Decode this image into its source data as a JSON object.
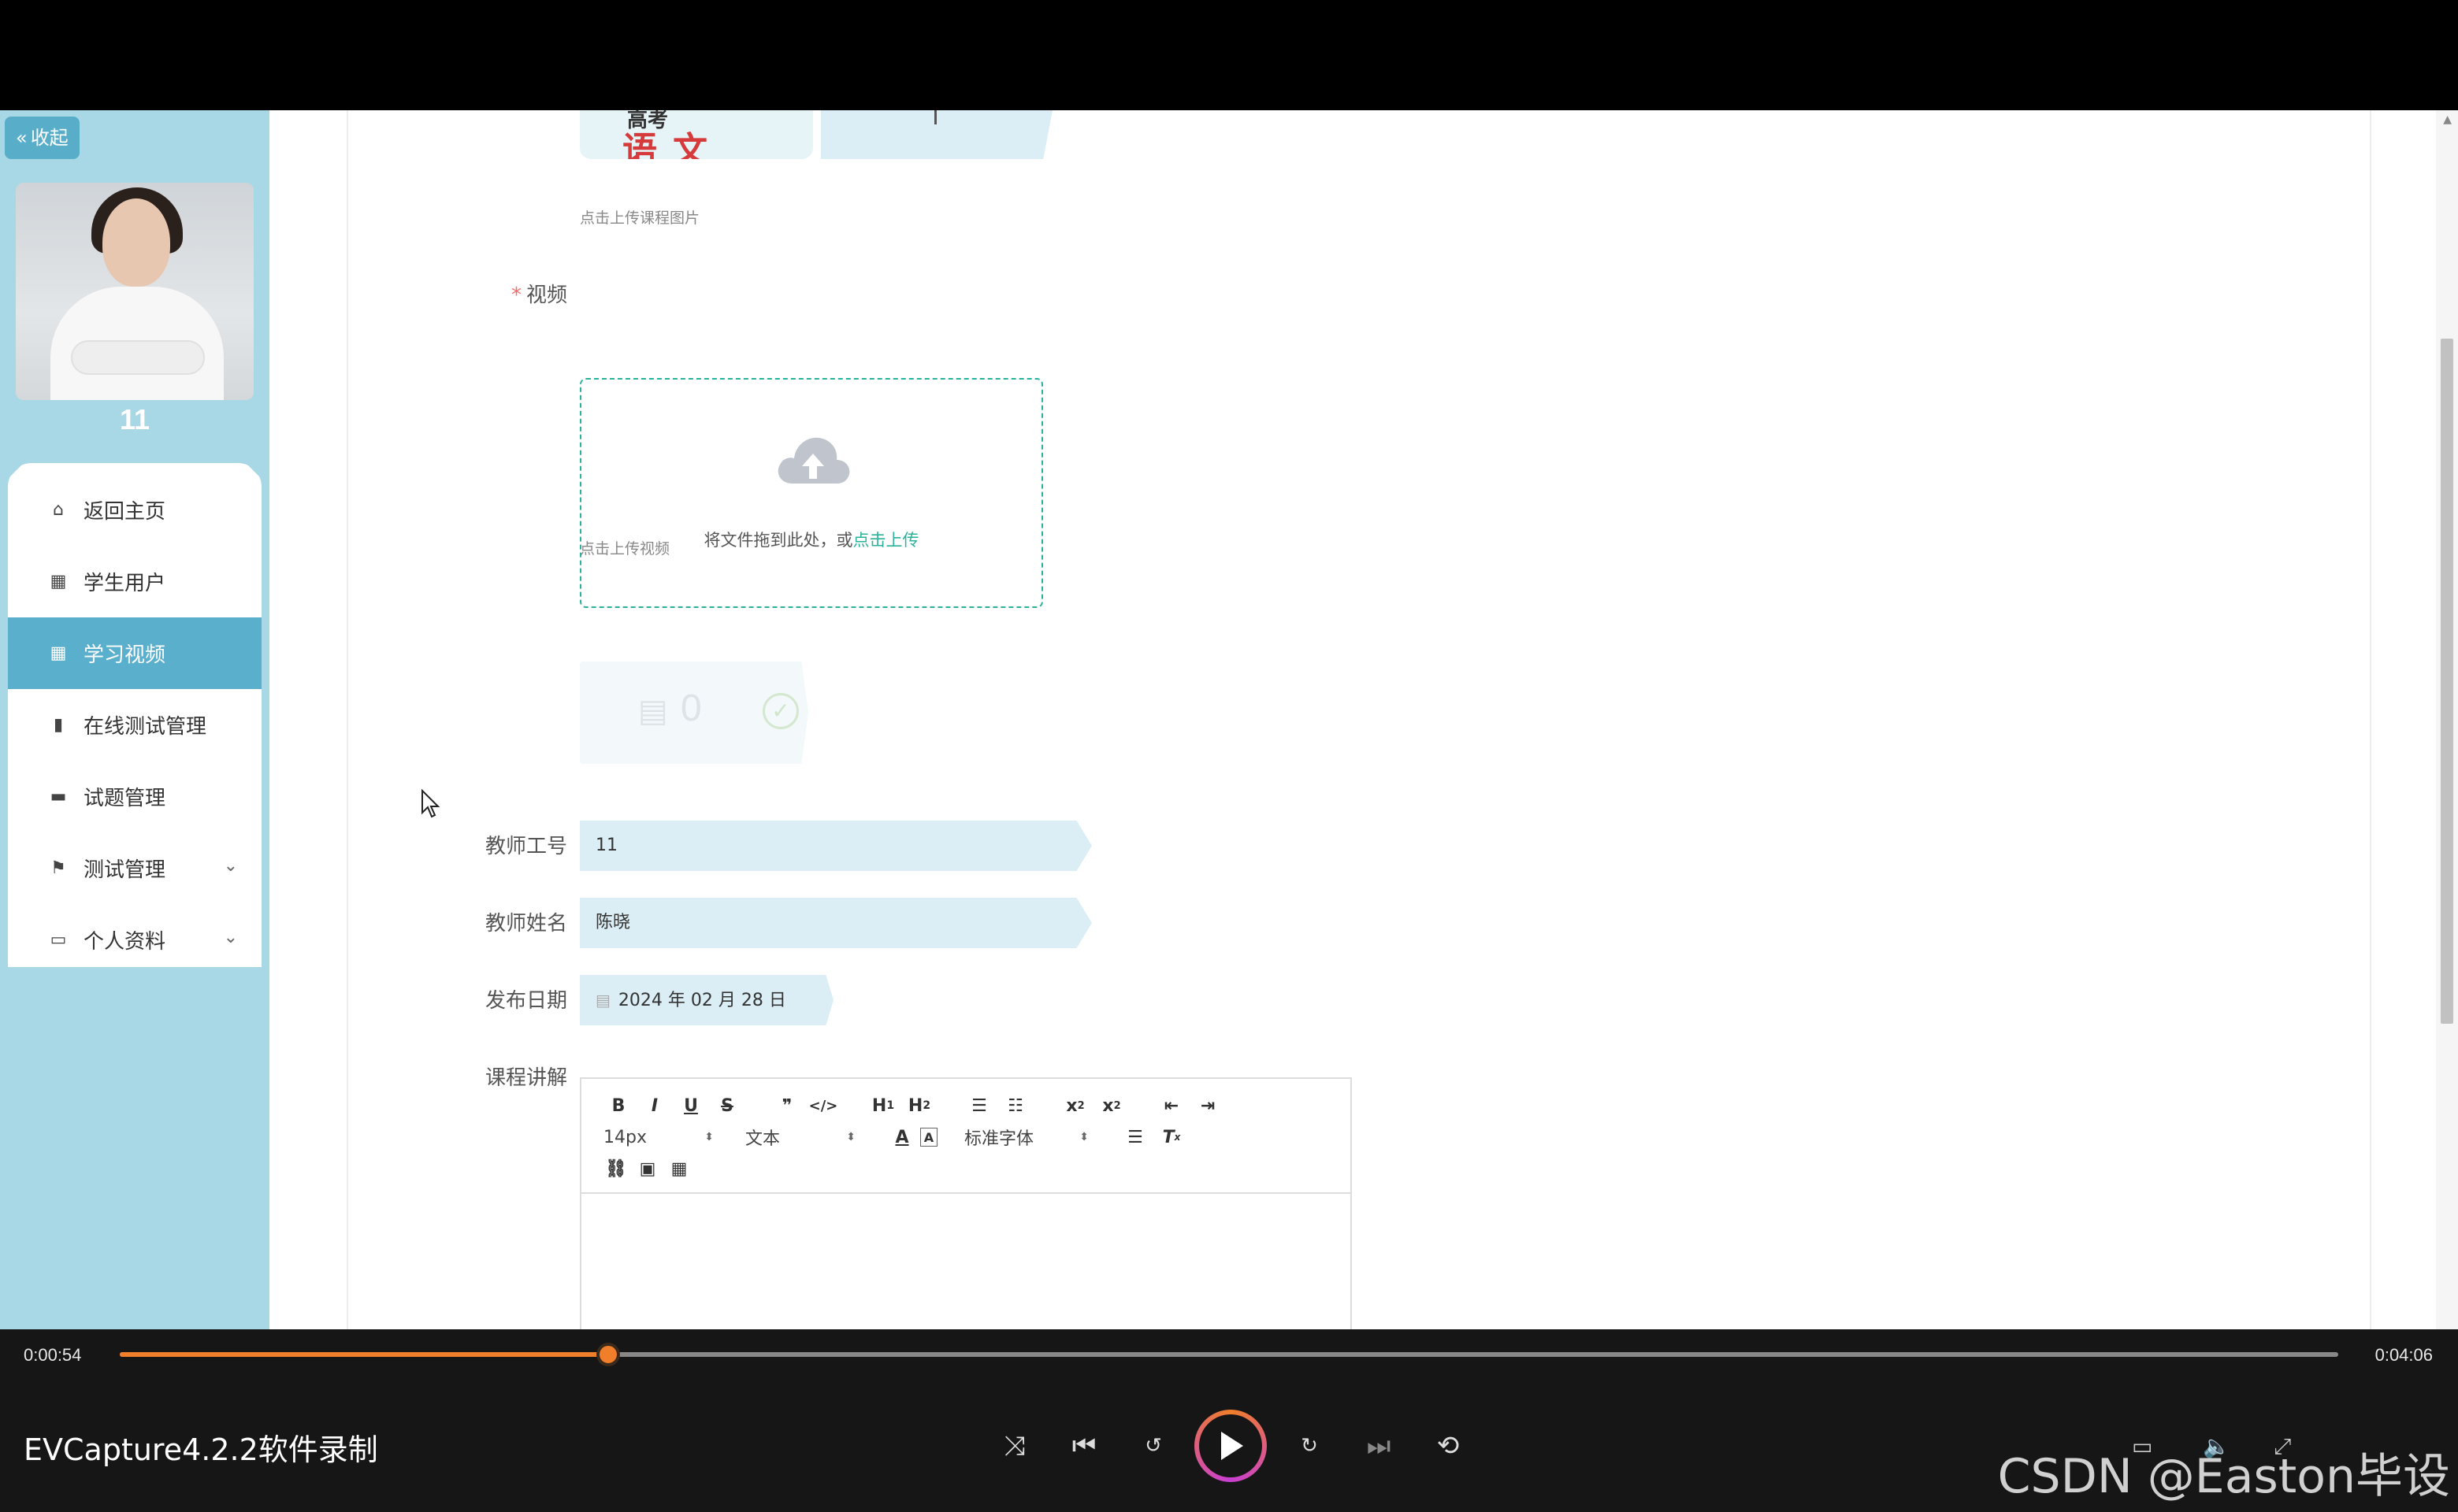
{
  "sidebar": {
    "collapse_label": "收起",
    "username": "11",
    "items": [
      {
        "label": "返回主页",
        "icon": "home-icon"
      },
      {
        "label": "学生用户",
        "icon": "grid-icon"
      },
      {
        "label": "学习视频",
        "icon": "grid-icon",
        "active": true
      },
      {
        "label": "在线测试管理",
        "icon": "bars-icon"
      },
      {
        "label": "试题管理",
        "icon": "monitor-icon"
      },
      {
        "label": "测试管理",
        "icon": "flag-icon",
        "expandable": true
      },
      {
        "label": "个人资料",
        "icon": "calendar-icon",
        "expandable": true
      }
    ]
  },
  "form": {
    "course_image": {
      "preview_top_text": "高考",
      "preview_main_text": "语文",
      "hint": "点击上传课程图片"
    },
    "video": {
      "label": "视频",
      "drop_text": "将文件拖到此处，或",
      "drop_link": "点击上传",
      "hint": "点击上传视频",
      "file_count": "0"
    },
    "teacher_id": {
      "label": "教师工号",
      "value": "11"
    },
    "teacher_name": {
      "label": "教师姓名",
      "value": "陈晓"
    },
    "publish_date": {
      "label": "发布日期",
      "value": "2024 年 02 月 28 日"
    },
    "course_desc": {
      "label": "课程讲解"
    }
  },
  "editor": {
    "row1": [
      "B",
      "I",
      "U",
      "S",
      "❞",
      "</>",
      "H1",
      "H2",
      "OL",
      "UL",
      "x₂",
      "x²",
      "outdent",
      "indent"
    ],
    "font_size": "14px",
    "header_select": "文本",
    "font_family": "标准字体"
  },
  "player": {
    "time_current": "0:00:54",
    "time_total": "0:04:06",
    "progress": 0.22,
    "title": "EVCapture4.2.2软件录制",
    "watermark": "CSDN @Easton毕设"
  },
  "colors": {
    "sidebar_bg": "#a8d8e6",
    "active_item": "#5aafcc",
    "accent_teal": "#2bb29b",
    "progress_orange": "#f07e2a"
  }
}
